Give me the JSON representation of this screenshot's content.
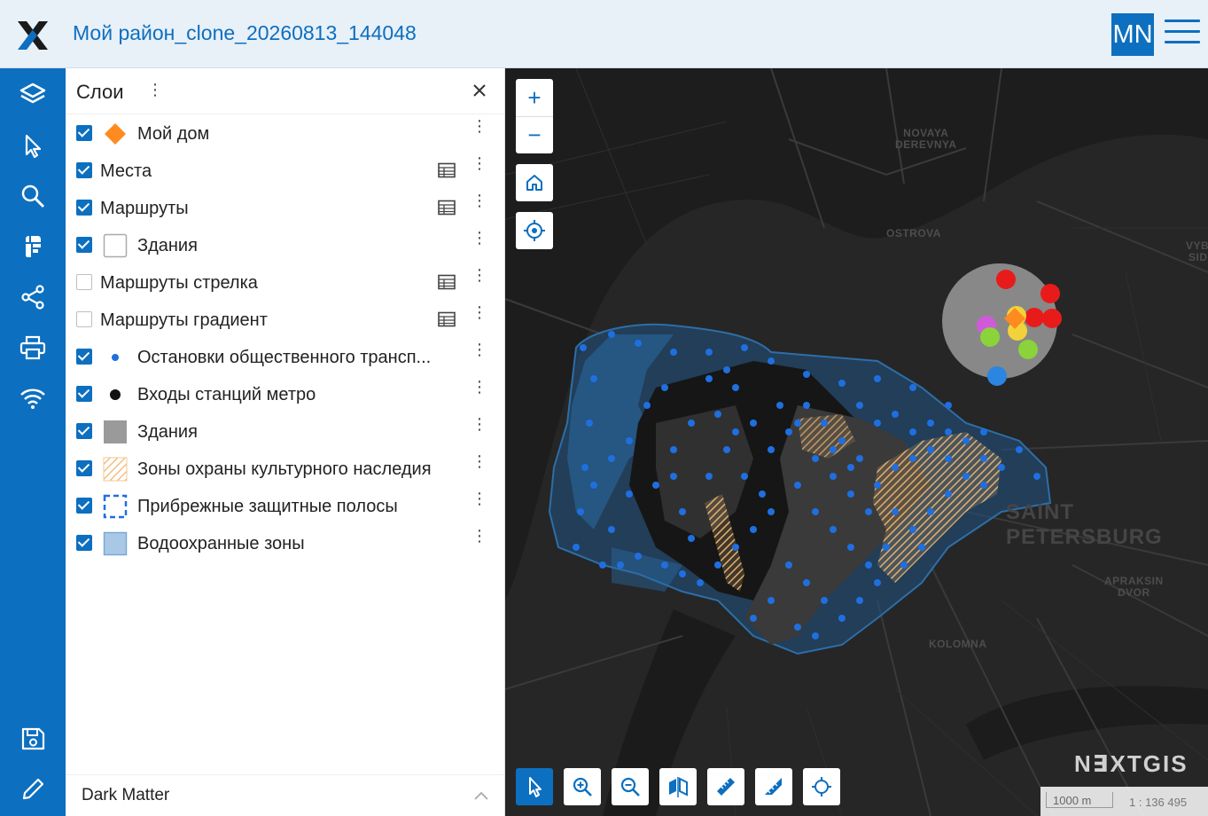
{
  "header": {
    "title": "Мой район_clone_20260813_144048",
    "avatar_initials": "MN",
    "brand_color": "#0d6fbf"
  },
  "rail": {
    "items": [
      "layers-icon",
      "select-icon",
      "search-icon",
      "print-map-icon",
      "share-icon",
      "printer-icon",
      "wifi-icon",
      "save-icon",
      "edit-icon"
    ]
  },
  "panel": {
    "title": "Слои",
    "layers": [
      {
        "name": "Мой дом",
        "checked": true,
        "symbol": "orange-diamond",
        "table": false
      },
      {
        "name": "Места",
        "checked": true,
        "symbol": "",
        "table": true
      },
      {
        "name": "Маршруты",
        "checked": true,
        "symbol": "",
        "table": true
      },
      {
        "name": "Здания",
        "checked": true,
        "symbol": "white-square",
        "table": false
      },
      {
        "name": "Маршруты стрелка",
        "checked": false,
        "symbol": "",
        "table": true
      },
      {
        "name": "Маршруты градиент",
        "checked": false,
        "symbol": "",
        "table": true
      },
      {
        "name": "Остановки общественного трансп...",
        "checked": true,
        "symbol": "blue-dot",
        "table": false
      },
      {
        "name": "Входы станций метро",
        "checked": true,
        "symbol": "black-dot",
        "table": false
      },
      {
        "name": "Здания",
        "checked": true,
        "symbol": "gray-square",
        "table": false
      },
      {
        "name": "Зоны охраны культурного наследия",
        "checked": true,
        "symbol": "hatched-orange",
        "table": false
      },
      {
        "name": "Прибрежные защитные полосы",
        "checked": true,
        "symbol": "dashed-blue",
        "table": false
      },
      {
        "name": "Водоохранные зоны",
        "checked": true,
        "symbol": "lightblue-square",
        "table": false
      }
    ],
    "basemap": "Dark Matter"
  },
  "map": {
    "labels": {
      "novaya_derevnya": "NOVAYA\nDEREVNYA",
      "ostrova": "OSTROVA",
      "vybo": "VYBO\nSIDE",
      "saint_petersburg": "SAINT PETERSBURG",
      "apraksin": "APRAKSIN\nDVOR",
      "kolomna": "KOLOMNA"
    },
    "brand": "N∃XTGIS",
    "scale_text": "1000 m",
    "scale_ratio": "1 : 136 495"
  }
}
